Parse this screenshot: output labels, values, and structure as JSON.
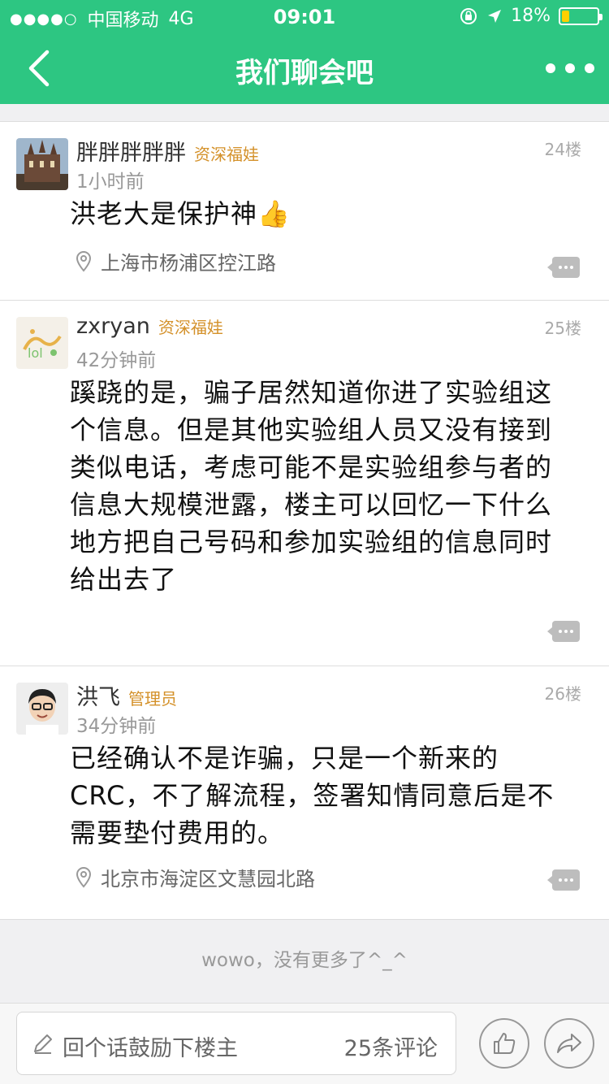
{
  "status_bar": {
    "signal_dots": "●●●●○",
    "carrier": "中国移动",
    "network": "4G",
    "time": "09:01",
    "battery": "18%",
    "battery_level": 0.18
  },
  "nav": {
    "title": "我们聊会吧"
  },
  "posts": [
    {
      "username": "胖胖胖胖胖",
      "badge": "资深福娃",
      "time": "1小时前",
      "floor": "24楼",
      "text": "洪老大是保护神👍",
      "location": "上海市杨浦区控江路"
    },
    {
      "username": "zxryan",
      "badge": "资深福娃",
      "time": "42分钟前",
      "floor": "25楼",
      "text": "蹊跷的是，骗子居然知道你进了实验组这个信息。但是其他实验组人员又没有接到类似电话，考虑可能不是实验组参与者的信息大规模泄露，楼主可以回忆一下什么地方把自己号码和参加实验组的信息同时给出去了",
      "location": ""
    },
    {
      "username": "洪飞",
      "badge": "管理员",
      "time": "34分钟前",
      "floor": "26楼",
      "text": "已经确认不是诈骗，只是一个新来的CRC，不了解流程，签署知情同意后是不需要垫付费用的。",
      "location": "北京市海淀区文慧园北路"
    }
  ],
  "footer": {
    "end_message": "wowo，没有更多了^_^"
  },
  "bottom_bar": {
    "reply_placeholder": "回个话鼓励下楼主",
    "comment_count": "25条评论"
  },
  "colors": {
    "brand_green": "#2dc682",
    "badge_gold": "#d4912a"
  }
}
